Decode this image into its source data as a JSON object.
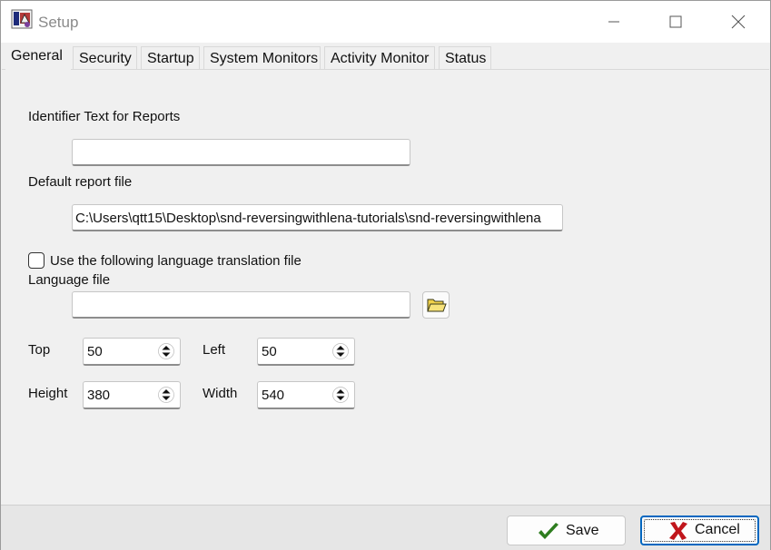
{
  "window": {
    "title": "Setup",
    "controls": [
      "minimize-icon",
      "maximize-icon",
      "close-icon"
    ]
  },
  "tabs": [
    {
      "label": "General",
      "active": true
    },
    {
      "label": "Security",
      "active": false
    },
    {
      "label": "Startup",
      "active": false
    },
    {
      "label": "System Monitors",
      "active": false
    },
    {
      "label": "Activity Monitor",
      "active": false
    },
    {
      "label": "Status",
      "active": false
    }
  ],
  "general": {
    "identifier_label": "Identifier Text for Reports",
    "identifier_value": "",
    "report_file_label": "Default report file",
    "report_file_value": "C:\\Users\\qtt15\\Desktop\\snd-reversingwithlena-tutorials\\snd-reversingwithlena",
    "use_language_label": "Use the following language translation file",
    "use_language_checked": false,
    "language_file_label": "Language file",
    "language_file_value": "",
    "browse_icon": "folder-open-icon",
    "top_label": "Top",
    "top_value": "50",
    "left_label": "Left",
    "left_value": "50",
    "height_label": "Height",
    "height_value": "380",
    "width_label": "Width",
    "width_value": "540"
  },
  "footer": {
    "save_label": "Save",
    "save_icon": "checkmark-icon",
    "cancel_label": "Cancel",
    "cancel_icon": "x-cancel-icon"
  },
  "colors": {
    "checkmark": "#2e7d1f",
    "cancel_x": "#c0151b",
    "focus_border": "#0067c0"
  }
}
